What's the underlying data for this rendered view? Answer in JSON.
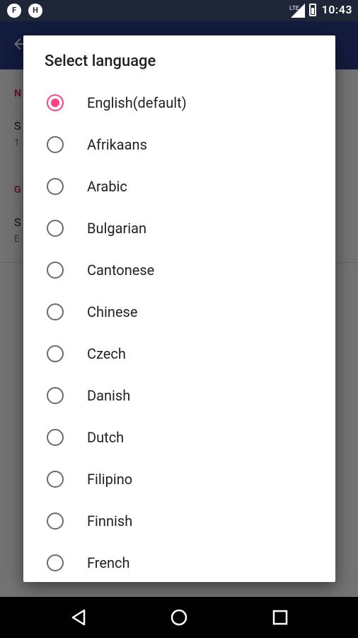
{
  "status_bar": {
    "time": "10:43",
    "notification_icons": [
      "F",
      "H"
    ],
    "network_label": "LTE",
    "accent_bg": "#1f2638"
  },
  "background_screen": {
    "sections": [
      {
        "header": "N",
        "item_title": "S",
        "item_sub": "1"
      },
      {
        "header": "G",
        "item_title": "S",
        "item_sub": "E"
      }
    ]
  },
  "dialog": {
    "title": "Select language",
    "options": [
      {
        "label": "English(default)",
        "selected": true
      },
      {
        "label": "Afrikaans",
        "selected": false
      },
      {
        "label": "Arabic",
        "selected": false
      },
      {
        "label": "Bulgarian",
        "selected": false
      },
      {
        "label": "Cantonese",
        "selected": false
      },
      {
        "label": "Chinese",
        "selected": false
      },
      {
        "label": "Czech",
        "selected": false
      },
      {
        "label": "Danish",
        "selected": false
      },
      {
        "label": "Dutch",
        "selected": false
      },
      {
        "label": "Filipino",
        "selected": false
      },
      {
        "label": "Finnish",
        "selected": false
      },
      {
        "label": "French",
        "selected": false
      }
    ]
  },
  "colors": {
    "accent": "#ff4081",
    "app_bar": "#2b3f8a"
  }
}
